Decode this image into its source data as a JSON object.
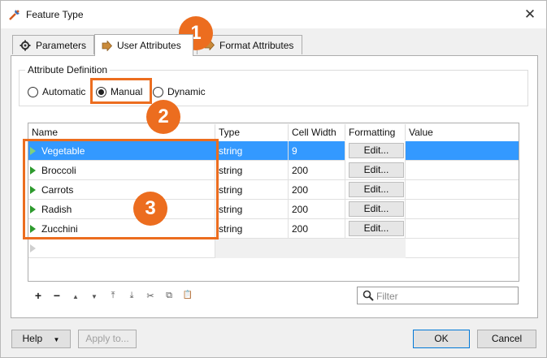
{
  "window": {
    "title": "Feature Type",
    "close_glyph": "✕"
  },
  "tabs": [
    {
      "label": "Parameters",
      "icon": "gear-icon"
    },
    {
      "label": "User Attributes",
      "icon": "arrow-right-icon"
    },
    {
      "label": "Format Attributes",
      "icon": "arrow-right-icon"
    }
  ],
  "attribute_definition": {
    "title": "Attribute Definition",
    "options": [
      "Automatic",
      "Manual",
      "Dynamic"
    ],
    "selected": "Manual"
  },
  "table": {
    "headers": [
      "Name",
      "Type",
      "Cell Width",
      "Formatting",
      "Value"
    ],
    "rows": [
      {
        "name": "Vegetable",
        "type": "string",
        "width": "9",
        "formatting": "Edit...",
        "value": ""
      },
      {
        "name": "Broccoli",
        "type": "string",
        "width": "200",
        "formatting": "Edit...",
        "value": ""
      },
      {
        "name": "Carrots",
        "type": "string",
        "width": "200",
        "formatting": "Edit...",
        "value": ""
      },
      {
        "name": "Radish",
        "type": "string",
        "width": "200",
        "formatting": "Edit...",
        "value": ""
      },
      {
        "name": "Zucchini",
        "type": "string",
        "width": "200",
        "formatting": "Edit...",
        "value": ""
      }
    ]
  },
  "toolbar": {
    "add": "+",
    "remove": "−",
    "move_up": "▲",
    "move_down": "▼",
    "move_top": "⤒",
    "move_bottom": "⤓",
    "cut": "✂",
    "copy": "⧉",
    "paste": "📋"
  },
  "filter": {
    "placeholder": "Filter"
  },
  "buttons": {
    "help": "Help",
    "apply": "Apply to...",
    "ok": "OK",
    "cancel": "Cancel",
    "help_arrow": "▼"
  },
  "annotations": [
    "1",
    "2",
    "3"
  ],
  "colors": {
    "accent": "#ec6d1f",
    "selection": "#3399ff",
    "expander": "#2e9a2e"
  }
}
